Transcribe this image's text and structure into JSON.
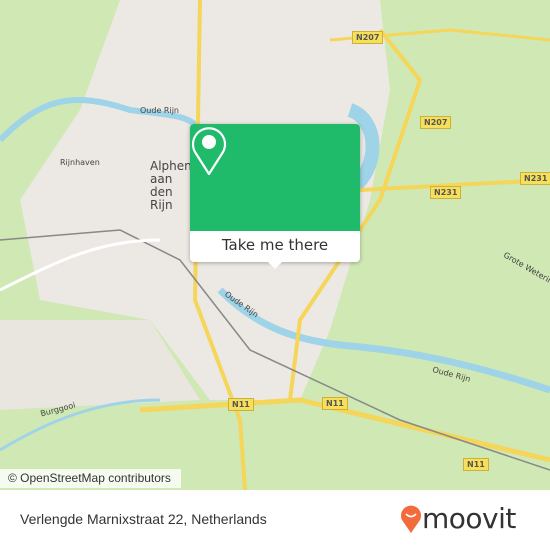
{
  "map": {
    "labels": {
      "oude_rijn_1": "Oude Rijn",
      "oude_rijn_2": "Oude Rijn",
      "oude_rijn_3": "Oude Rijn",
      "rijnhaven": "Rijnhaven",
      "burggooi": "Burggooi",
      "grote_wetering": "Grote Wetering",
      "city": "Alphen aan den Rijn"
    },
    "shields": [
      "N207",
      "N207",
      "N231",
      "N231",
      "N11",
      "N11",
      "N11"
    ],
    "attribution": "© OpenStreetMap contributors"
  },
  "popup": {
    "button_label": "Take me there",
    "icon": "map-pin-icon",
    "color": "#1fbb6b"
  },
  "footer": {
    "address": "Verlengde Marnixstraat 22, Netherlands",
    "brand": "moovit",
    "brand_color": "#f26b3a"
  }
}
